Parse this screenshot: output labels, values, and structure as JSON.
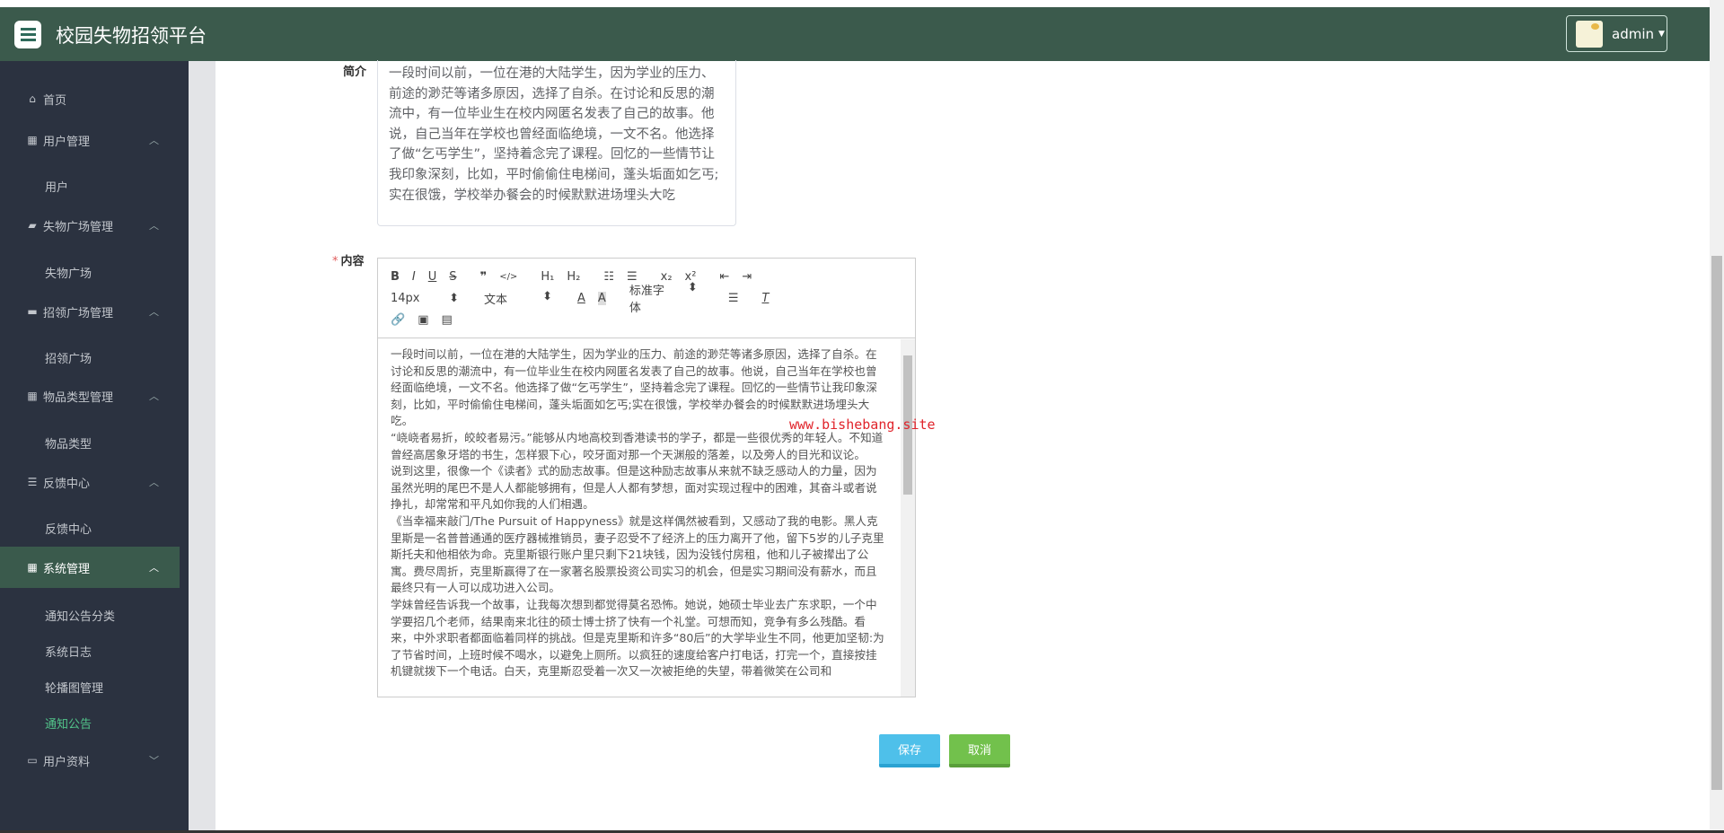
{
  "header": {
    "title": "校园失物招领平台",
    "user": "admin"
  },
  "sidebar": {
    "items": [
      {
        "label": "首页",
        "icon": "home-icon"
      },
      {
        "label": "用户管理",
        "icon": "grid-icon",
        "sub": [
          "用户"
        ]
      },
      {
        "label": "失物广场管理",
        "icon": "folder-icon",
        "sub": [
          "失物广场"
        ]
      },
      {
        "label": "招领广场管理",
        "icon": "briefcase-icon",
        "sub": [
          "招领广场"
        ]
      },
      {
        "label": "物品类型管理",
        "icon": "grid-icon",
        "sub": [
          "物品类型"
        ]
      },
      {
        "label": "反馈中心",
        "icon": "list-icon",
        "sub": [
          "反馈中心"
        ]
      },
      {
        "label": "系统管理",
        "icon": "grid-icon",
        "active": true,
        "sub": [
          "通知公告分类",
          "系统日志",
          "轮播图管理",
          "通知公告"
        ]
      },
      {
        "label": "用户资料",
        "icon": "calendar-icon"
      }
    ],
    "active_sub": "通知公告"
  },
  "form": {
    "intro_label": "简介",
    "intro_value": "一段时间以前，一位在港的大陆学生，因为学业的压力、前途的渺茫等诸多原因，选择了自杀。在讨论和反思的潮流中，有一位毕业生在校内网匿名发表了自己的故事。他说，自己当年在学校也曾经面临绝境，一文不名。他选择了做“乞丐学生”，坚持着念完了课程。回忆的一些情节让我印象深刻，比如，平时偷偷住电梯间，蓬头垢面如乞丐;实在很饿，学校举办餐会的时候默默进场埋头大吃",
    "content_label": "内容",
    "toolbar": {
      "font_size": "14px",
      "header": "文本",
      "font": "标准字体"
    },
    "content": [
      "一段时间以前，一位在港的大陆学生，因为学业的压力、前途的渺茫等诸多原因，选择了自杀。在讨论和反思的潮流中，有一位毕业生在校内网匿名发表了自己的故事。他说，自己当年在学校也曾经面临绝境，一文不名。他选择了做“乞丐学生”，坚持着念完了课程。回忆的一些情节让我印象深刻，比如，平时偷偷住电梯间，蓬头垢面如乞丐;实在很饿，学校举办餐会的时候默默进场埋头大吃。",
      "“峣峣者易折，皎皎者易污。”能够从内地高校到香港读书的学子，都是一些很优秀的年轻人。不知道曾经高居象牙塔的书生，怎样狠下心，咬牙面对那一个天渊般的落差，以及旁人的目光和议论。",
      "说到这里，很像一个《读者》式的励志故事。但是这种励志故事从来就不缺乏感动人的力量，因为虽然光明的尾巴不是人人都能够拥有，但是人人都有梦想，面对实现过程中的困难，其奋斗或者说挣扎，却常常和平凡如你我的人们相遇。",
      "《当幸福来敲门/The Pursuit of Happyness》就是这样偶然被看到，又感动了我的电影。黑人克里斯是一名普普通通的医疗器械推销员，妻子忍受不了经济上的压力离开了他，留下5岁的儿子克里斯托夫和他相依为命。克里斯银行账户里只剩下21块钱，因为没钱付房租，他和儿子被撵出了公寓。费尽周折，克里斯赢得了在一家著名股票投资公司实习的机会，但是实习期间没有薪水，而且最终只有一人可以成功进入公司。",
      "学妹曾经告诉我一个故事，让我每次想到都觉得莫名恐怖。她说，她硕士毕业去广东求职，一个中学要招几个老师，结果南来北往的硕士博士挤了快有一个礼堂。可想而知，竞争有多么残酷。看来，中外求职者都面临着同样的挑战。但是克里斯和许多“80后”的大学毕业生不同，他更加坚韧:为了节省时间，上班时候不喝水，以避免上厕所。以疯狂的速度给客户打电话，打完一个，直接按挂机键就拨下一个电话。白天，克里斯忍受着一次又一次被拒绝的失望，带着微笑在公司和"
    ],
    "save": "保存",
    "cancel": "取消"
  },
  "watermark": "www.bishebang.site"
}
